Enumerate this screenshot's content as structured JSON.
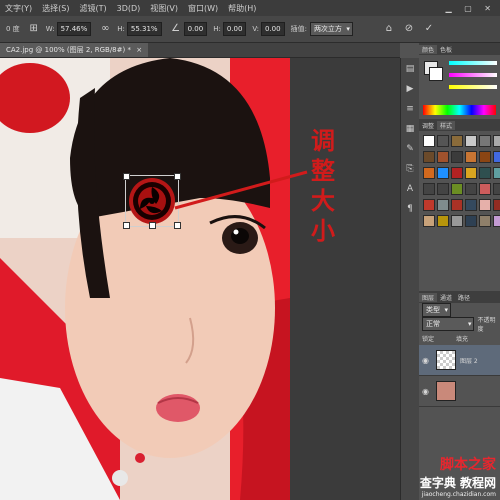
{
  "menubar": {
    "items": [
      "文字(Y)",
      "选择(S)",
      "滤镜(T)",
      "3D(D)",
      "视图(V)",
      "窗口(W)",
      "帮助(H)"
    ]
  },
  "options": {
    "angle_label": "0 度",
    "w_label": "W:",
    "w_value": "57.46%",
    "h_label": "H:",
    "h_value": "55.31%",
    "rot_value": "0.00",
    "h2_label": "H:",
    "h2_value": "0.00",
    "v_label": "V:",
    "v_value": "0.00",
    "interp_label": "插值:",
    "interp_value": "两次立方"
  },
  "doc": {
    "tab_label": "CA2.jpg @ 100% (图层 2, RGB/8#) *"
  },
  "annotation": {
    "chars": [
      "调",
      "整",
      "大",
      "小"
    ]
  },
  "panels": {
    "color_tabs": [
      "颜色",
      "色板"
    ],
    "adjust_tabs": [
      "调整",
      "样式"
    ],
    "layer_tabs": [
      "图层",
      "通道",
      "路径"
    ],
    "kind_label": "类型",
    "blend_mode": "正常",
    "opacity_label": "不透明度",
    "lock_label": "锁定",
    "fill_label": "填充",
    "layer_name": "图层 2"
  },
  "watermark": {
    "line1": "脚本之家",
    "line2": "查字典 教程网",
    "url": "jiaocheng.chazidian.com"
  },
  "colors": {
    "annotation_red": "#d11b1b",
    "menubar_bg": "#3c3c3c",
    "panel_bg": "#535353"
  }
}
